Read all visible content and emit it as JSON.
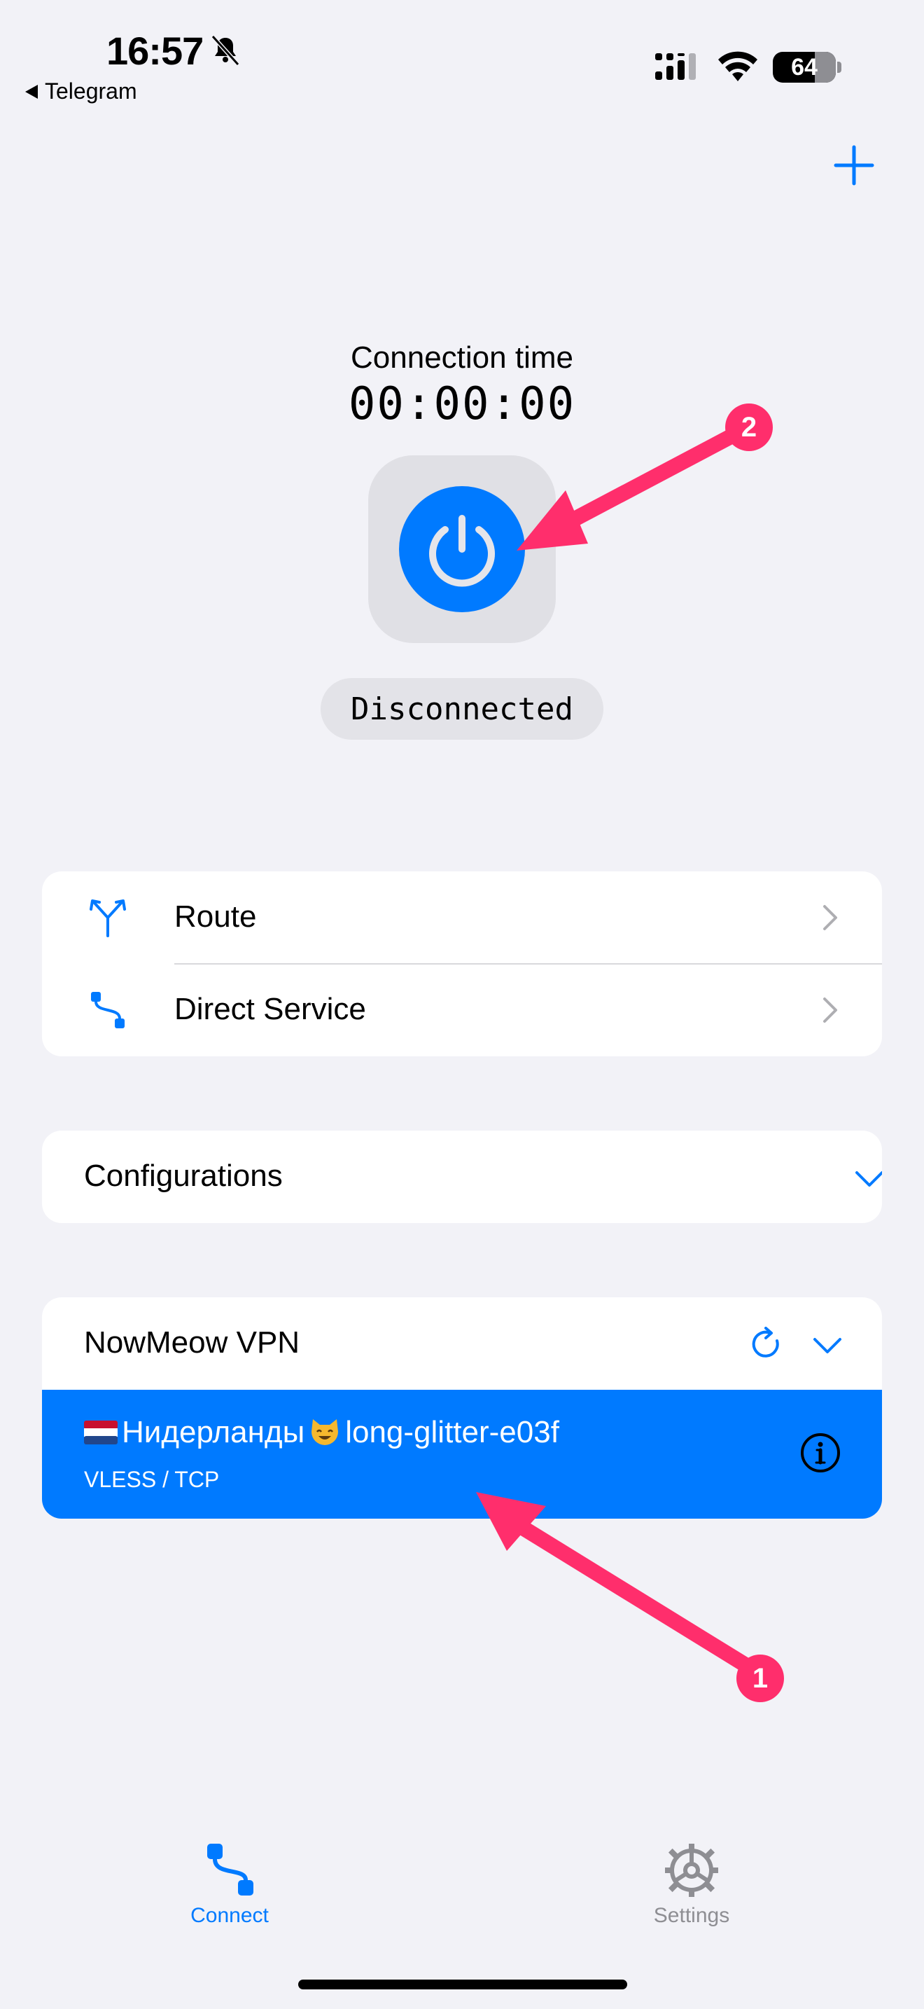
{
  "status_bar": {
    "time": "16:57",
    "back_app": "Telegram",
    "battery": "64"
  },
  "connection": {
    "label": "Connection time",
    "timer": "00:00:00",
    "status": "Disconnected"
  },
  "menu": {
    "route_label": "Route",
    "direct_service_label": "Direct Service"
  },
  "configurations": {
    "label": "Configurations"
  },
  "vpn_group": {
    "name": "NowMeow VPN",
    "server": {
      "name_part1": "Нидерланды",
      "name_part2": "long-glitter-e03f",
      "protocol": "VLESS / TCP"
    }
  },
  "annotations": {
    "badge_1": "1",
    "badge_2": "2"
  },
  "tab_bar": {
    "connect_label": "Connect",
    "settings_label": "Settings"
  },
  "colors": {
    "accent": "#007aff",
    "background": "#f2f2f7",
    "annotation": "#ff2e6c"
  },
  "icons": {
    "plus": "plus-icon",
    "power": "power-icon",
    "route": "route-fork-icon",
    "direct": "direct-connect-icon",
    "refresh": "refresh-icon",
    "info": "info-icon",
    "settings": "gear-icon"
  }
}
